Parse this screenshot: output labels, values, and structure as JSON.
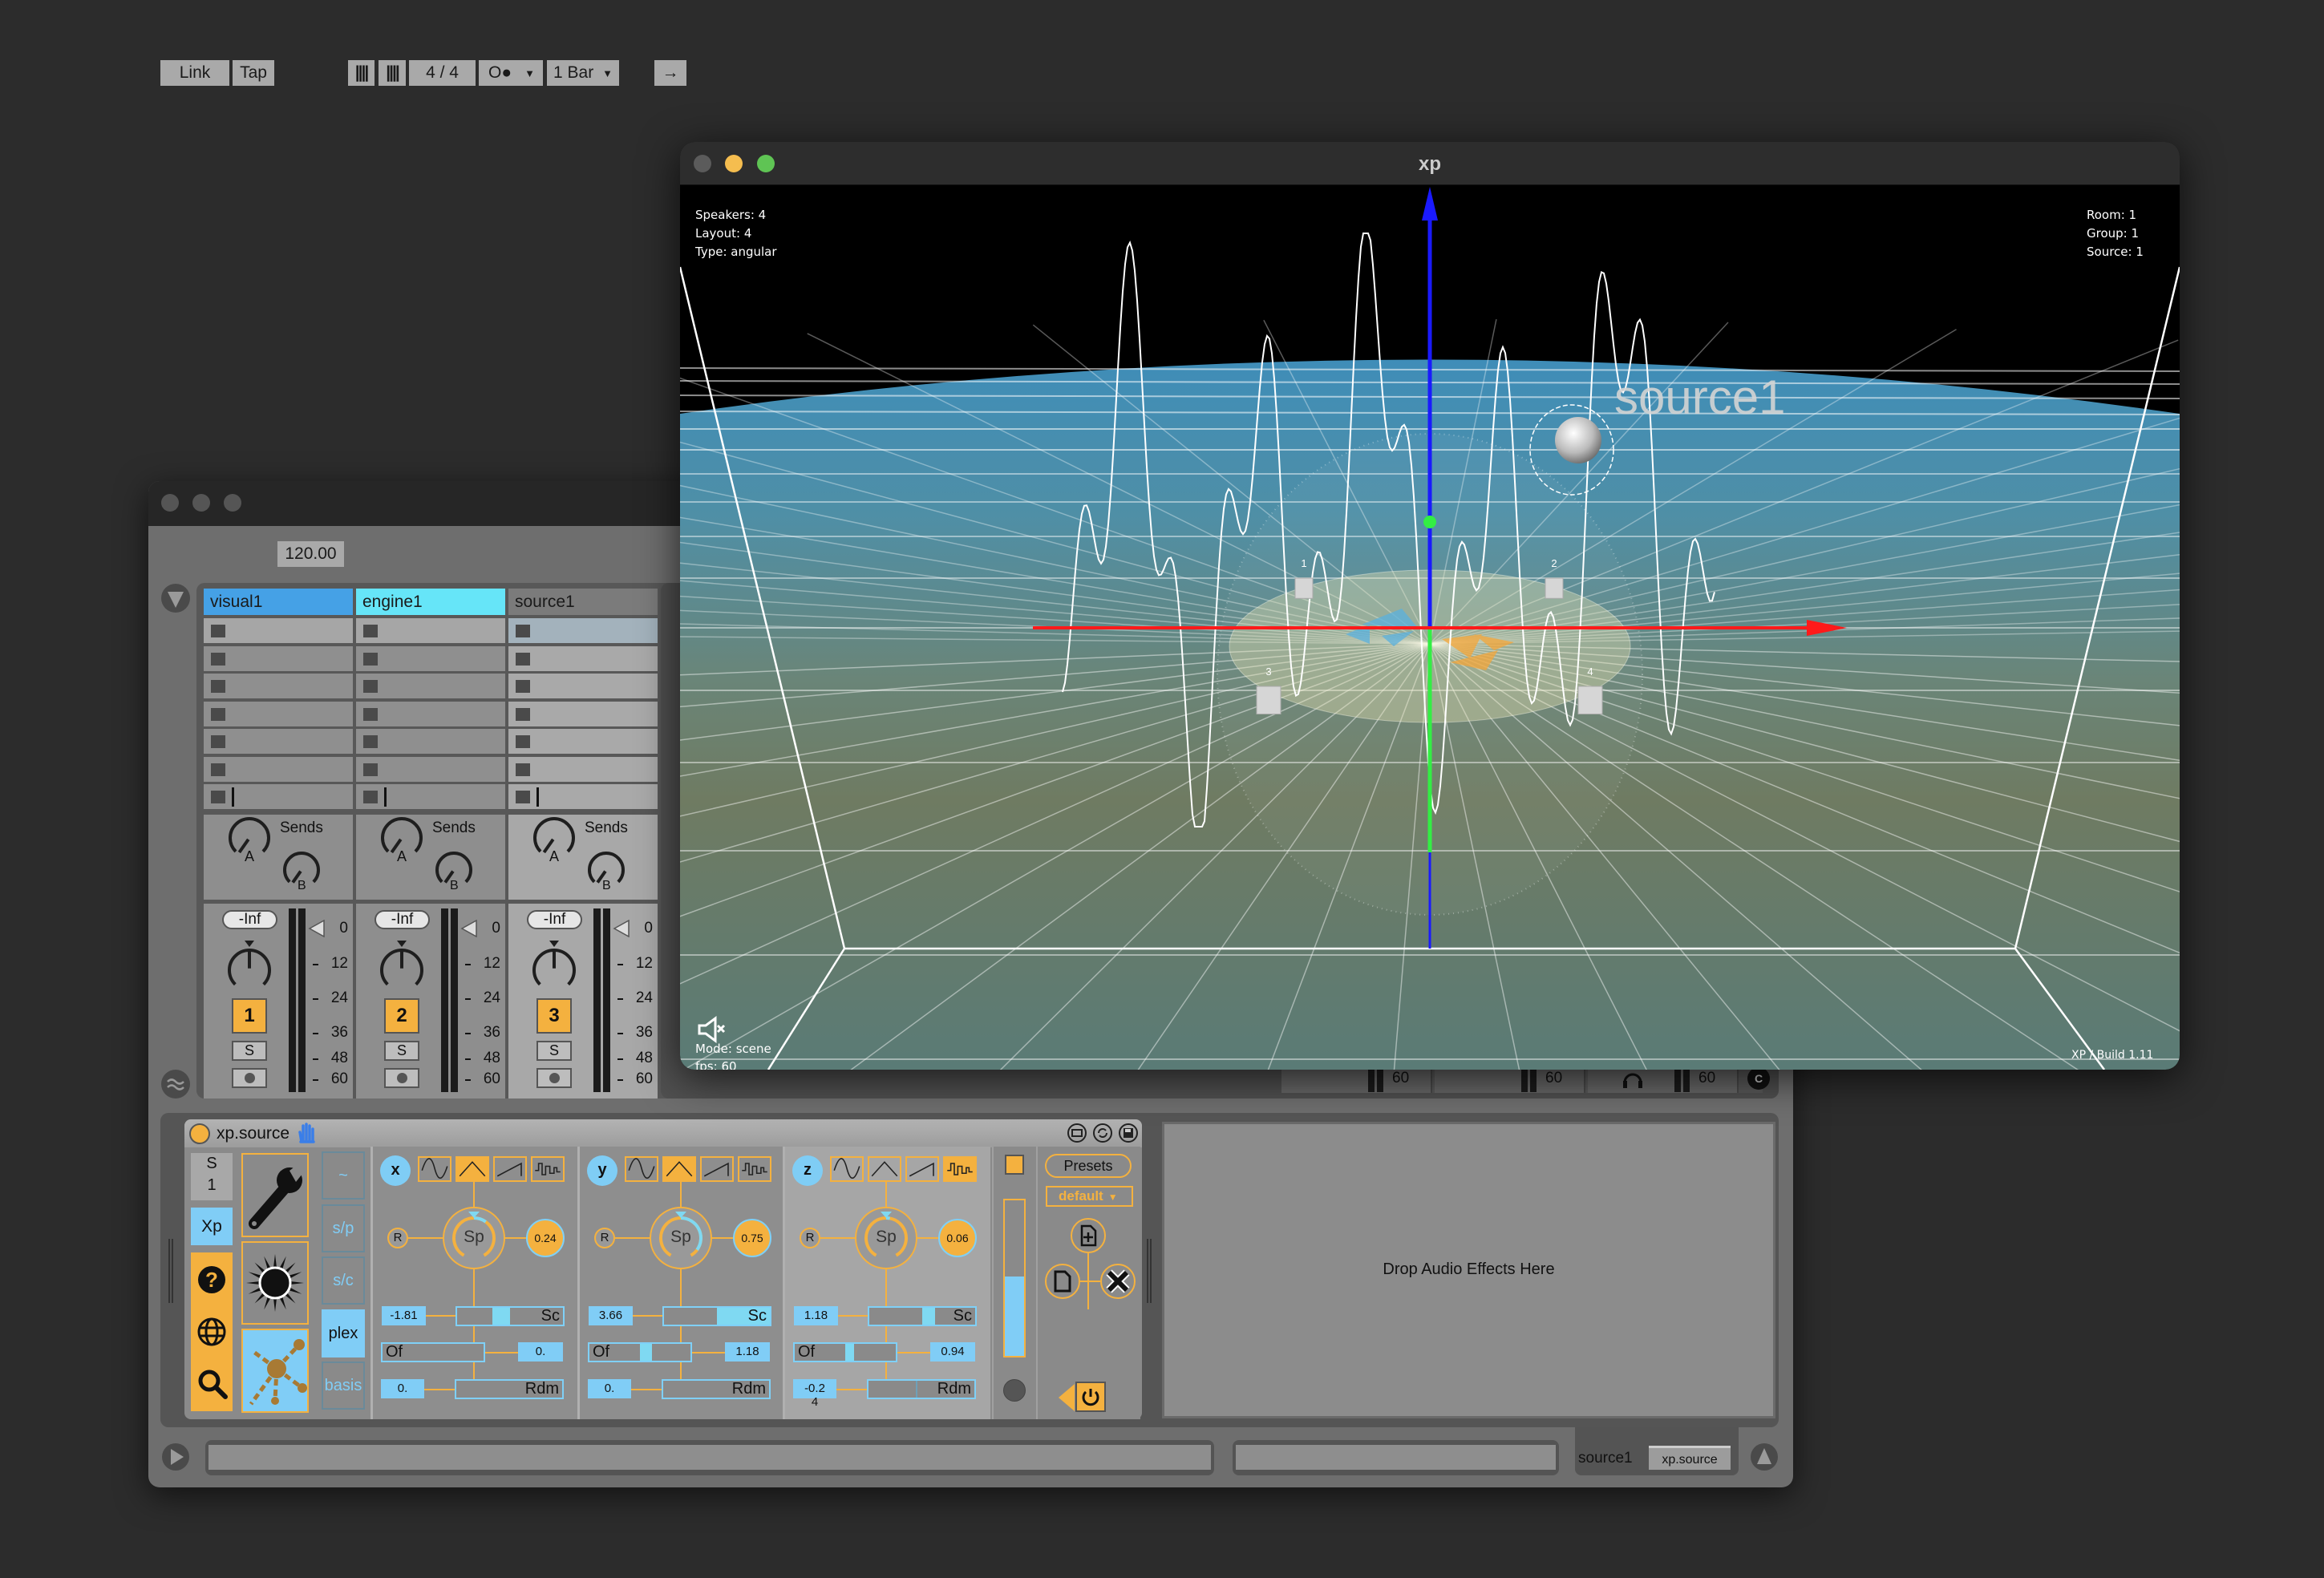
{
  "ableton": {
    "toolbar": {
      "link": "Link",
      "tap": "Tap",
      "tempo": "120.00",
      "nudge_down": "||||",
      "nudge_up": "||||",
      "time_signature": "4 / 4",
      "metronome": "O●",
      "quantize": "1 Bar",
      "follow_arrow": "→"
    },
    "tracks": [
      {
        "name": "visual1",
        "color": "#45a1e6",
        "volume": "-Inf",
        "sends_label": "Sends",
        "send_a": "A",
        "send_b": "B",
        "number": "1",
        "solo": "S"
      },
      {
        "name": "engine1",
        "color": "#66e5f8",
        "volume": "-Inf",
        "sends_label": "Sends",
        "send_a": "A",
        "send_b": "B",
        "number": "2",
        "solo": "S"
      },
      {
        "name": "source1",
        "color": "#7b7b7b",
        "volume": "-Inf",
        "sends_label": "Sends",
        "send_a": "A",
        "send_b": "B",
        "number": "3",
        "solo": "S"
      }
    ],
    "meter_scale": [
      "0",
      "12",
      "24",
      "36",
      "48",
      "60"
    ],
    "hidden_strip_meters": [
      "60",
      "60",
      "60"
    ],
    "device": {
      "title": "xp.source",
      "s_label": "S",
      "s_number": "1",
      "xp_tab": "Xp",
      "tabs": [
        "~",
        "s/p",
        "s/c",
        "plex",
        "basis"
      ],
      "active_tab": "plex",
      "lfos": [
        {
          "axis": "x",
          "waveform": "triangle",
          "reset": "R",
          "speed_label": "Sp",
          "speed": "0.24",
          "scale": "-1.81",
          "scale_label": "Sc",
          "offset_label": "Of",
          "offset": "0.",
          "random": "0.",
          "random_label": "Rdm"
        },
        {
          "axis": "y",
          "waveform": "triangle",
          "reset": "R",
          "speed_label": "Sp",
          "speed": "0.75",
          "scale": "3.66",
          "scale_label": "Sc",
          "offset_label": "Of",
          "offset": "1.18",
          "random": "0.",
          "random_label": "Rdm"
        },
        {
          "axis": "z",
          "waveform": "step",
          "reset": "R",
          "speed_label": "Sp",
          "speed": "0.06",
          "scale": "1.18",
          "scale_label": "Sc",
          "offset_label": "Of",
          "offset": "0.94",
          "random": "-0.24",
          "random_label": "Rdm"
        }
      ],
      "presets_label": "Presets",
      "preset": "default",
      "colors": {
        "accent": "#f4b13f",
        "highlight": "#80cdf6"
      }
    },
    "drop_text": "Drop Audio Effects Here",
    "status": {
      "track": "source1",
      "device": "xp.source"
    }
  },
  "xp": {
    "title": "xp",
    "info_left": [
      "Speakers: 4",
      "Layout: 4",
      "Type: angular"
    ],
    "info_right": [
      "Room: 1",
      "Group: 1",
      "Source: 1"
    ],
    "mode": "Mode: scene",
    "fps": "fps: 60",
    "build": "XP / Build 1.11",
    "source_label": "source1",
    "speaker_labels": [
      "1",
      "2",
      "3",
      "4"
    ],
    "axis_colors": {
      "x": "#ff1a1a",
      "y": "#33ee44",
      "z": "#1a1aff"
    }
  }
}
